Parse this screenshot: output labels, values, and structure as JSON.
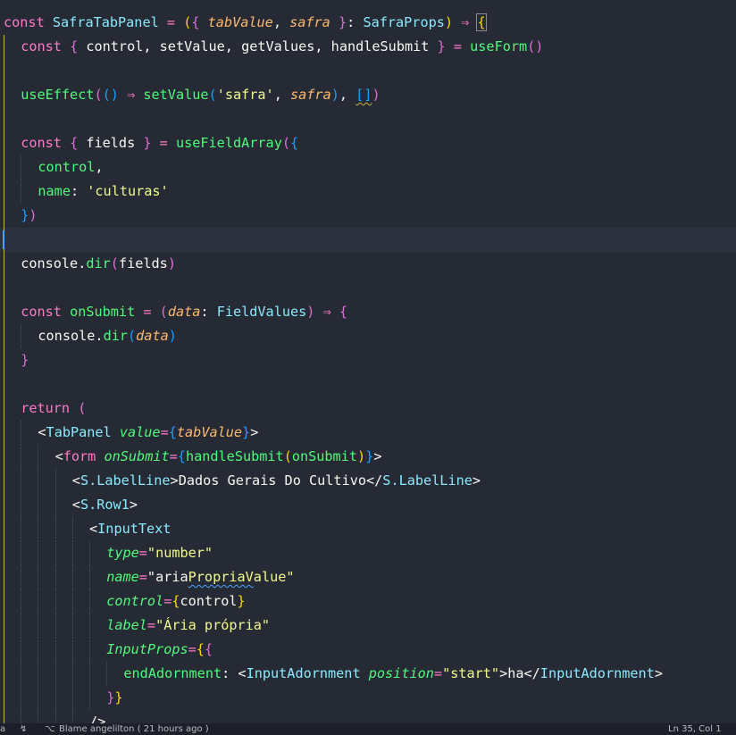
{
  "editor": {
    "language": "tsx",
    "current_line": 9,
    "lines": [
      {
        "indent": 0,
        "tokens": [
          [
            "const ",
            "k"
          ],
          [
            "SafraTabPanel",
            "c"
          ],
          [
            " = ",
            "k"
          ],
          [
            "(",
            "b1"
          ],
          [
            "{",
            "b2"
          ],
          [
            " "
          ],
          [
            "tabValue",
            "p"
          ],
          [
            ", "
          ],
          [
            "safra",
            "p"
          ],
          [
            " "
          ],
          [
            "}",
            "b2"
          ],
          [
            ": "
          ],
          [
            "SafraProps",
            "t"
          ],
          [
            ")",
            "b1"
          ],
          [
            " ⇒ ",
            "k"
          ],
          [
            "{",
            "b1 match"
          ]
        ]
      },
      {
        "indent": 1,
        "tokens": [
          [
            "const ",
            "k"
          ],
          [
            "{",
            "b2"
          ],
          [
            " control, setValue, getValues, handleSubmit "
          ],
          [
            "}",
            "b2"
          ],
          [
            " = ",
            "k"
          ],
          [
            "useForm",
            "f"
          ],
          [
            "()",
            "b2"
          ]
        ]
      },
      {
        "indent": 1,
        "tokens": []
      },
      {
        "indent": 1,
        "tokens": [
          [
            "useEffect",
            "f"
          ],
          [
            "(",
            "b2"
          ],
          [
            "()",
            "b3"
          ],
          [
            " ⇒ ",
            "k"
          ],
          [
            "setValue",
            "f"
          ],
          [
            "(",
            "b3"
          ],
          [
            "'safra'",
            "s"
          ],
          [
            ", "
          ],
          [
            "safra",
            "p"
          ],
          [
            ")",
            "b3"
          ],
          [
            ", "
          ],
          [
            "[]",
            "b3 sqy"
          ],
          [
            ")",
            "b2"
          ]
        ]
      },
      {
        "indent": 1,
        "tokens": []
      },
      {
        "indent": 1,
        "tokens": [
          [
            "const ",
            "k"
          ],
          [
            "{",
            "b2"
          ],
          [
            " fields "
          ],
          [
            "}",
            "b2"
          ],
          [
            " = ",
            "k"
          ],
          [
            "useFieldArray",
            "f"
          ],
          [
            "(",
            "b2"
          ],
          [
            "{",
            "b3"
          ]
        ]
      },
      {
        "indent": 2,
        "tokens": [
          [
            "control",
            "p2"
          ],
          [
            ","
          ]
        ]
      },
      {
        "indent": 2,
        "tokens": [
          [
            "name",
            "p2"
          ],
          [
            ": "
          ],
          [
            "'culturas'",
            "s"
          ]
        ]
      },
      {
        "indent": 1,
        "tokens": [
          [
            "}",
            "b3"
          ],
          [
            ")",
            "b2"
          ]
        ]
      },
      {
        "indent": 1,
        "tokens": []
      },
      {
        "indent": 1,
        "tokens": [
          [
            "console",
            "c0"
          ],
          [
            "."
          ],
          [
            "dir",
            "f"
          ],
          [
            "(",
            "b2"
          ],
          [
            "fields"
          ],
          [
            ")",
            "b2"
          ]
        ]
      },
      {
        "indent": 1,
        "tokens": []
      },
      {
        "indent": 1,
        "tokens": [
          [
            "const ",
            "k"
          ],
          [
            "onSubmit",
            "f"
          ],
          [
            " = ",
            "k"
          ],
          [
            "(",
            "b2"
          ],
          [
            "data",
            "p"
          ],
          [
            ": "
          ],
          [
            "FieldValues",
            "t"
          ],
          [
            ")",
            "b2"
          ],
          [
            " ⇒ ",
            "k"
          ],
          [
            "{",
            "b2"
          ]
        ]
      },
      {
        "indent": 2,
        "tokens": [
          [
            "console",
            "c0"
          ],
          [
            "."
          ],
          [
            "dir",
            "f"
          ],
          [
            "(",
            "b3"
          ],
          [
            "data",
            "p"
          ],
          [
            ")",
            "b3"
          ]
        ]
      },
      {
        "indent": 1,
        "tokens": [
          [
            "}",
            "b2"
          ]
        ]
      },
      {
        "indent": 1,
        "tokens": []
      },
      {
        "indent": 1,
        "tokens": [
          [
            "return ",
            "k"
          ],
          [
            "(",
            "b2"
          ]
        ]
      },
      {
        "indent": 2,
        "tokens": [
          [
            "<"
          ],
          [
            "TabPanel",
            "t"
          ],
          [
            " "
          ],
          [
            "value",
            "at"
          ],
          [
            "=",
            "k"
          ],
          [
            "{",
            "b3"
          ],
          [
            "tabValue",
            "p"
          ],
          [
            "}",
            "b3"
          ],
          [
            ">"
          ]
        ]
      },
      {
        "indent": 3,
        "tokens": [
          [
            "<"
          ],
          [
            "form",
            "tg"
          ],
          [
            " "
          ],
          [
            "onSubmit",
            "at"
          ],
          [
            "=",
            "k"
          ],
          [
            "{",
            "b3"
          ],
          [
            "handleSubmit",
            "f"
          ],
          [
            "(",
            "b1"
          ],
          [
            "onSubmit",
            "f"
          ],
          [
            ")",
            "b1"
          ],
          [
            "}",
            "b3"
          ],
          [
            ">"
          ]
        ]
      },
      {
        "indent": 4,
        "tokens": [
          [
            "<"
          ],
          [
            "S.LabelLine",
            "t"
          ],
          [
            ">Dados Gerais Do Cultivo</"
          ],
          [
            "S.LabelLine",
            "t"
          ],
          [
            ">"
          ]
        ]
      },
      {
        "indent": 4,
        "tokens": [
          [
            "<"
          ],
          [
            "S.Row1",
            "t"
          ],
          [
            ">"
          ]
        ]
      },
      {
        "indent": 5,
        "tokens": [
          [
            "<"
          ],
          [
            "InputText",
            "t"
          ]
        ]
      },
      {
        "indent": 6,
        "tokens": [
          [
            "type",
            "at"
          ],
          [
            "=",
            "k"
          ],
          [
            "\"number\"",
            "s"
          ]
        ]
      },
      {
        "indent": 6,
        "tokens": [
          [
            "name",
            "at"
          ],
          [
            "=",
            "k"
          ],
          [
            "\"aria"
          ],
          [
            "PropriaV",
            "s sq"
          ],
          [
            "alue\"",
            "s"
          ]
        ]
      },
      {
        "indent": 6,
        "tokens": [
          [
            "control",
            "at"
          ],
          [
            "=",
            "k"
          ],
          [
            "{",
            "b1"
          ],
          [
            "control"
          ],
          [
            "}",
            "b1"
          ]
        ]
      },
      {
        "indent": 6,
        "tokens": [
          [
            "label",
            "at"
          ],
          [
            "=",
            "k"
          ],
          [
            "\"Ária própria\"",
            "s"
          ]
        ]
      },
      {
        "indent": 6,
        "tokens": [
          [
            "InputProps",
            "at"
          ],
          [
            "=",
            "k"
          ],
          [
            "{",
            "b1"
          ],
          [
            "{",
            "b2"
          ]
        ]
      },
      {
        "indent": 7,
        "tokens": [
          [
            "endAdornment",
            "p2"
          ],
          [
            ": "
          ],
          [
            "<"
          ],
          [
            "InputAdornment",
            "t"
          ],
          [
            " "
          ],
          [
            "position",
            "at"
          ],
          [
            "=",
            "k"
          ],
          [
            "\"start\"",
            "s"
          ],
          [
            ">ha</"
          ],
          [
            "InputAdornment",
            "t"
          ],
          [
            ">"
          ]
        ]
      },
      {
        "indent": 6,
        "tokens": [
          [
            "}",
            "b2"
          ],
          [
            "}",
            "b1"
          ]
        ]
      },
      {
        "indent": 5,
        "tokens": [
          [
            "/>"
          ]
        ]
      }
    ]
  },
  "status": {
    "blame": "Blame angelilton ( 21 hours ago )",
    "position": "Ln 35, Col 1",
    "left_glyph": "a"
  }
}
